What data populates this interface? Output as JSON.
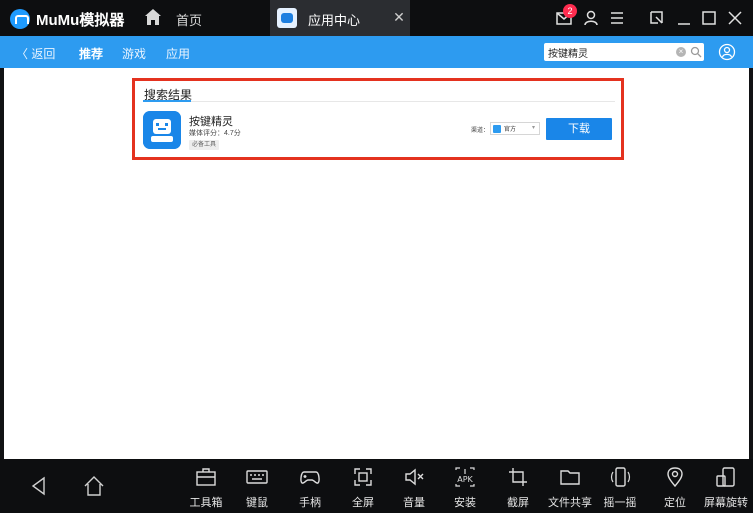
{
  "window": {
    "app_title": "MuMu模拟器",
    "tabs": [
      {
        "label": "首页"
      },
      {
        "label": "应用中心"
      }
    ],
    "mail_badge_count": "2"
  },
  "nav": {
    "back": "〈 返回",
    "recommend": "推荐",
    "games": "游戏",
    "apps": "应用"
  },
  "search": {
    "value": "按键精灵"
  },
  "results": {
    "heading": "搜索结果",
    "items": [
      {
        "name": "按键精灵",
        "rating": "媒体评分：4.7分",
        "tag": "必备工具",
        "channel_label": "渠道：",
        "channel_value": "官方",
        "download_label": "下载"
      }
    ]
  },
  "toolbar": {
    "tools": [
      {
        "label": "工具箱",
        "icon": "toolbox-icon"
      },
      {
        "label": "键鼠",
        "icon": "keyboard-icon"
      },
      {
        "label": "手柄",
        "icon": "gamepad-icon"
      },
      {
        "label": "全屏",
        "icon": "fullscreen-icon"
      },
      {
        "label": "音量",
        "icon": "volume-mute-icon"
      },
      {
        "label": "安装",
        "icon": "apk-install-icon"
      },
      {
        "label": "截屏",
        "icon": "crop-icon"
      },
      {
        "label": "文件共享",
        "icon": "folder-icon"
      },
      {
        "label": "摇一摇",
        "icon": "shake-icon"
      },
      {
        "label": "定位",
        "icon": "location-icon"
      },
      {
        "label": "屏幕旋转",
        "icon": "rotate-screen-icon"
      }
    ]
  },
  "colors": {
    "accent_blue": "#2d9bf0",
    "download_blue": "#1a86e8",
    "highlight_red": "#e4321f",
    "badge_red": "#ff2c4f",
    "chrome_dark": "#0d0e10"
  }
}
